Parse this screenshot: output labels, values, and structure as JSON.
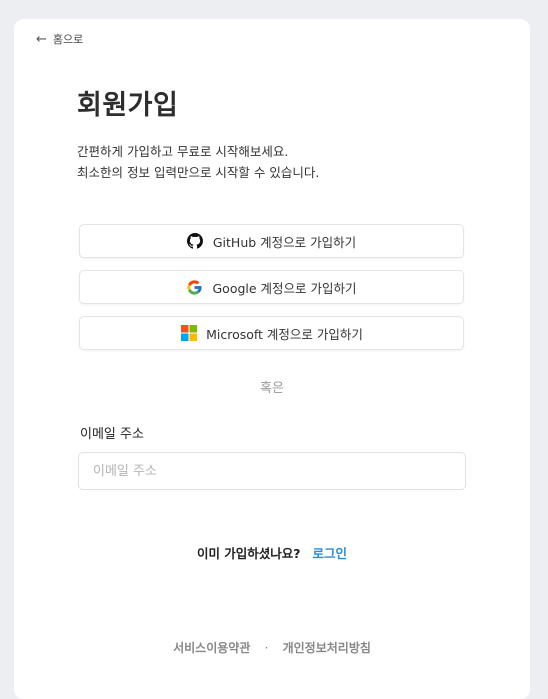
{
  "nav": {
    "back_label": "홈으로"
  },
  "page": {
    "title": "회원가입",
    "description": [
      "간편하게 가입하고 무료로 시작해보세요.",
      "최소한의 정보 입력만으로 시작할 수 있습니다."
    ]
  },
  "sso": {
    "github": {
      "label": "GitHub 계정으로 가입하기",
      "icon": "github-icon"
    },
    "google": {
      "label": "Google 계정으로 가입하기",
      "icon": "google-icon"
    },
    "microsoft": {
      "label": "Microsoft 계정으로 가입하기",
      "icon": "microsoft-icon"
    }
  },
  "divider": "혹은",
  "email": {
    "label": "이메일 주소",
    "placeholder": "이메일 주소",
    "value": ""
  },
  "login_prompt": {
    "question": "이미 가입하셨나요?",
    "link": "로그인"
  },
  "footer": {
    "terms": "서비스이용약관",
    "separator": "·",
    "privacy": "개인정보처리방침"
  },
  "colors": {
    "background": "#eceef1",
    "card": "#ffffff",
    "link": "#2a8cd6"
  }
}
